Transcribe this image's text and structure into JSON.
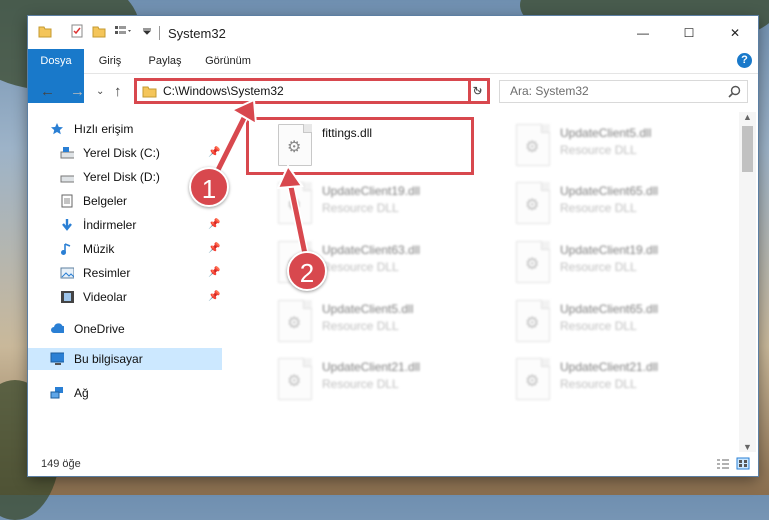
{
  "window": {
    "title": "System32",
    "controls": {
      "minimize": "—",
      "maximize": "☐",
      "close": "✕"
    }
  },
  "ribbon": {
    "tabs": [
      "Dosya",
      "Giriş",
      "Paylaş",
      "Görünüm"
    ],
    "help": "?"
  },
  "address": {
    "path": "C:\\Windows\\System32",
    "search_placeholder": "Ara: System32"
  },
  "sidebar": {
    "items": [
      {
        "label": "Hızlı erişim",
        "icon": "star-icon",
        "pinned": false
      },
      {
        "label": "Yerel Disk (C:)",
        "icon": "drive-icon",
        "pinned": true
      },
      {
        "label": "Yerel Disk (D:)",
        "icon": "drive-icon",
        "pinned": false
      },
      {
        "label": "Belgeler",
        "icon": "documents-icon",
        "pinned": true
      },
      {
        "label": "İndirmeler",
        "icon": "download-icon",
        "pinned": true
      },
      {
        "label": "Müzik",
        "icon": "music-icon",
        "pinned": true
      },
      {
        "label": "Resimler",
        "icon": "pictures-icon",
        "pinned": true
      },
      {
        "label": "Videolar",
        "icon": "videos-icon",
        "pinned": true
      },
      {
        "label": "OneDrive",
        "icon": "cloud-icon",
        "pinned": false
      },
      {
        "label": "Bu bilgisayar",
        "icon": "computer-icon",
        "pinned": false,
        "selected": true
      },
      {
        "label": "Ağ",
        "icon": "network-icon",
        "pinned": false
      }
    ]
  },
  "files": [
    {
      "name": "fittings.dll",
      "type": ""
    },
    {
      "name": "UpdateClient5.dll",
      "type": "Resource DLL"
    },
    {
      "name": "UpdateClient19.dll",
      "type": "Resource DLL"
    },
    {
      "name": "UpdateClient65.dll",
      "type": "Resource DLL"
    },
    {
      "name": "UpdateClient63.dll",
      "type": "Resource DLL"
    },
    {
      "name": "UpdateClient19.dll",
      "type": "Resource DLL"
    },
    {
      "name": "UpdateClient5.dll",
      "type": "Resource DLL"
    },
    {
      "name": "UpdateClient65.dll",
      "type": "Resource DLL"
    },
    {
      "name": "UpdateClient21.dll",
      "type": "Resource DLL"
    },
    {
      "name": "UpdateClient21.dll",
      "type": "Resource DLL"
    }
  ],
  "status": {
    "count": "149 öğe"
  },
  "annotations": {
    "step1": "1",
    "step2": "2",
    "color": "#d8484e"
  }
}
